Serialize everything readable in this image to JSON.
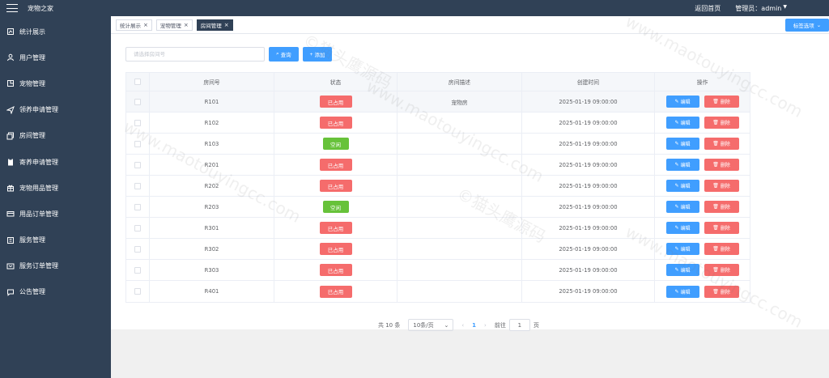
{
  "header": {
    "app_title": "宠物之家",
    "home_link": "返回首页",
    "admin_label": "管理员：admin"
  },
  "sidebar": {
    "items": [
      {
        "label": "统计展示",
        "icon": "chart-icon"
      },
      {
        "label": "用户管理",
        "icon": "user-icon"
      },
      {
        "label": "宠物管理",
        "icon": "pet-icon"
      },
      {
        "label": "领养申请管理",
        "icon": "send-icon"
      },
      {
        "label": "房间管理",
        "icon": "room-icon"
      },
      {
        "label": "寄养申请管理",
        "icon": "clipboard-icon"
      },
      {
        "label": "宠物用品管理",
        "icon": "gift-icon"
      },
      {
        "label": "用品订单管理",
        "icon": "order-icon"
      },
      {
        "label": "服务管理",
        "icon": "service-icon"
      },
      {
        "label": "服务订单管理",
        "icon": "service-order-icon"
      },
      {
        "label": "公告管理",
        "icon": "notice-icon"
      }
    ]
  },
  "tabs": [
    {
      "label": "统计展示",
      "active": false
    },
    {
      "label": "宠物管理",
      "active": false
    },
    {
      "label": "房间管理",
      "active": true
    }
  ],
  "tab_options_label": "标签选项",
  "search": {
    "placeholder": "请选择房间号",
    "query_label": "查询",
    "add_label": "添加"
  },
  "table": {
    "headers": [
      "房间号",
      "状态",
      "房间描述",
      "创建时间",
      "操作"
    ],
    "edit_label": "编辑",
    "delete_label": "删除",
    "rows": [
      {
        "no": "R101",
        "status": "已占用",
        "status_type": "occupied",
        "desc": "宠物房",
        "time": "2025-01-19 09:00:00"
      },
      {
        "no": "R102",
        "status": "已占用",
        "status_type": "occupied",
        "desc": "",
        "time": "2025-01-19 09:00:00"
      },
      {
        "no": "R103",
        "status": "空闲",
        "status_type": "free",
        "desc": "",
        "time": "2025-01-19 09:00:00"
      },
      {
        "no": "R201",
        "status": "已占用",
        "status_type": "occupied",
        "desc": "",
        "time": "2025-01-19 09:00:00"
      },
      {
        "no": "R202",
        "status": "已占用",
        "status_type": "occupied",
        "desc": "",
        "time": "2025-01-19 09:00:00"
      },
      {
        "no": "R203",
        "status": "空闲",
        "status_type": "free",
        "desc": "",
        "time": "2025-01-19 09:00:00"
      },
      {
        "no": "R301",
        "status": "已占用",
        "status_type": "occupied",
        "desc": "",
        "time": "2025-01-19 09:00:00"
      },
      {
        "no": "R302",
        "status": "已占用",
        "status_type": "occupied",
        "desc": "",
        "time": "2025-01-19 09:00:00"
      },
      {
        "no": "R303",
        "status": "已占用",
        "status_type": "occupied",
        "desc": "",
        "time": "2025-01-19 09:00:00"
      },
      {
        "no": "R401",
        "status": "已占用",
        "status_type": "occupied",
        "desc": "",
        "time": "2025-01-19 09:00:00"
      }
    ]
  },
  "pagination": {
    "total_label": "共 10 条",
    "page_size_label": "10条/页",
    "current_page": "1",
    "goto_label": "前往",
    "goto_value": "1",
    "page_unit": "页"
  },
  "watermark": {
    "cn": "©猫头鹰源码",
    "en": "www.maotouyingcc.com"
  },
  "colors": {
    "sidebar_bg": "#304156",
    "primary": "#409eff",
    "danger": "#f56c6c",
    "success": "#67c23a"
  }
}
